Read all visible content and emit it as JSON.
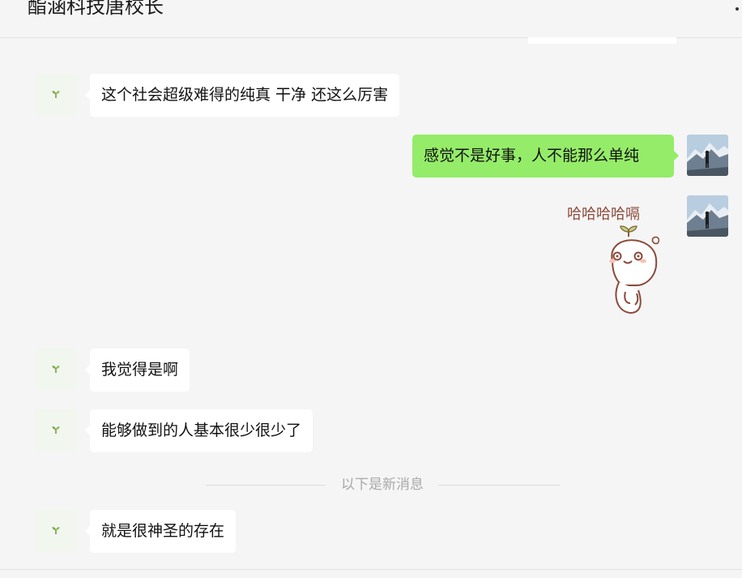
{
  "chat": {
    "title": "酯涵科技唐校长"
  },
  "messages": [
    {
      "side": "left",
      "text": "这个社会超级难得的纯真 干净 还这么厉害"
    },
    {
      "side": "right",
      "text": "感觉不是好事，人不能那么单纯"
    },
    {
      "side": "right",
      "type": "sticker",
      "text": "哈哈哈哈嗝"
    },
    {
      "side": "left",
      "text": "我觉得是啊"
    },
    {
      "side": "left",
      "text": "能够做到的人基本很少很少了"
    },
    {
      "side": "left",
      "text": "就是很神圣的存在"
    }
  ],
  "divider": {
    "label": "以下是新消息"
  },
  "colors": {
    "background": "#f5f5f5",
    "incoming_bubble": "#ffffff",
    "outgoing_bubble": "#95ec69",
    "divider_text": "#a9a9a9"
  }
}
